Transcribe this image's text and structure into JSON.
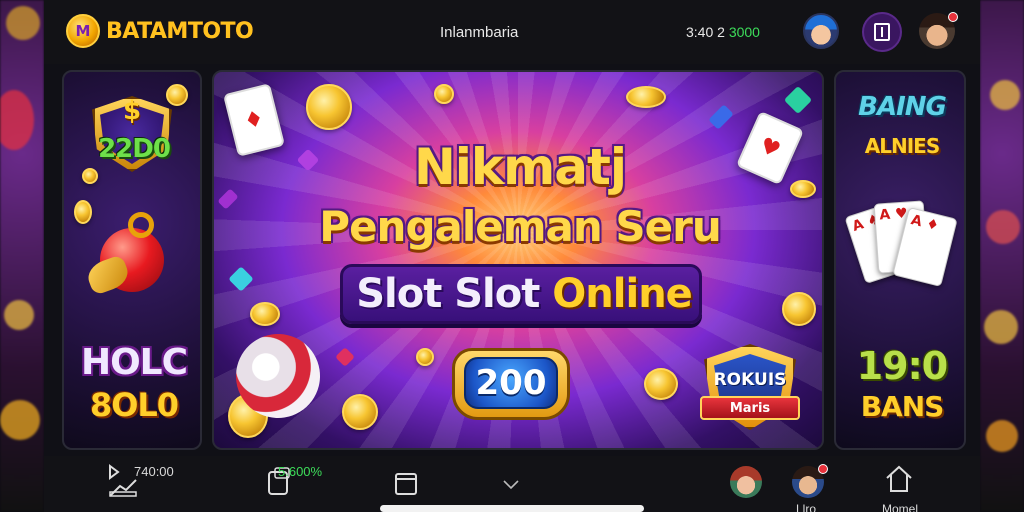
{
  "header": {
    "logo_mark": "M",
    "brand_prefix": "BATAM",
    "brand_suffix": "TOTO",
    "center_label": "Inlanmbaria",
    "balance_prefix": "3:40 2",
    "balance_value": "3000"
  },
  "banner": {
    "headline_line1": "Nikmatj",
    "headline_line2": "Pengaleman Seru",
    "headline_line3_a": "Slot Slot",
    "headline_line3_b": "Online",
    "badge_value": "200",
    "emblem_title": "ROKUIS",
    "emblem_ribbon": "Maris"
  },
  "left_panel": {
    "dollar_sign": "$",
    "amount": "22D0",
    "text_line1": "HOLC",
    "text_line2": "8OL0"
  },
  "right_panel": {
    "title1": "BAING",
    "title2": "ALNIES",
    "number": "19:0",
    "label": "BANS"
  },
  "bottom_bar": {
    "item1_value": "740:00",
    "item2_value": "5.600%",
    "label_avatar": "Llro",
    "label_home": "Momel"
  },
  "colors": {
    "accent_gold": "#ffcf2a",
    "green_value": "#3ddc5a",
    "notification": "#e8323c"
  }
}
